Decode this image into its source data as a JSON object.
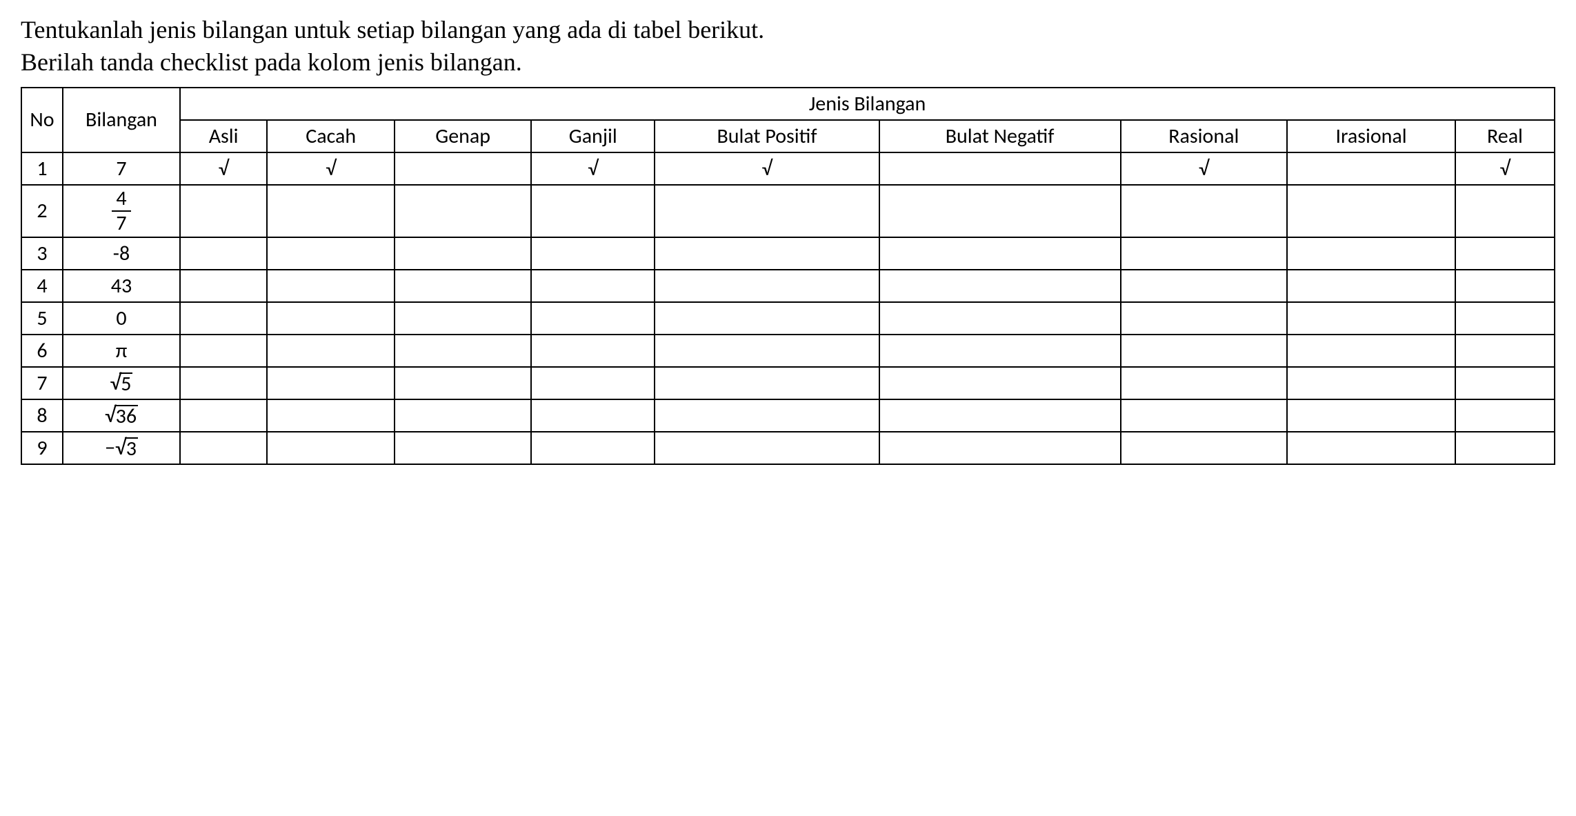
{
  "instruction": {
    "line1": "Tentukanlah jenis bilangan untuk setiap bilangan yang ada di tabel berikut.",
    "line2": "Berilah tanda checklist pada kolom jenis bilangan."
  },
  "headers": {
    "no": "No",
    "bilangan": "Bilangan",
    "jenis": "Jenis Bilangan",
    "cols": {
      "asli": "Asli",
      "cacah": "Cacah",
      "genap": "Genap",
      "ganjil": "Ganjil",
      "bulat_positif": "Bulat Positif",
      "bulat_negatif": "Bulat Negatif",
      "rasional": "Rasional",
      "irasional": "Irasional",
      "real": "Real"
    }
  },
  "check_symbol": "√",
  "rows": [
    {
      "no": "1",
      "bilangan": {
        "type": "text",
        "value": "7"
      },
      "check": {
        "asli": true,
        "cacah": true,
        "genap": false,
        "ganjil": true,
        "bulat_positif": true,
        "bulat_negatif": false,
        "rasional": true,
        "irasional": false,
        "real": true
      }
    },
    {
      "no": "2",
      "bilangan": {
        "type": "frac",
        "num": "4",
        "den": "7"
      },
      "check": {
        "asli": false,
        "cacah": false,
        "genap": false,
        "ganjil": false,
        "bulat_positif": false,
        "bulat_negatif": false,
        "rasional": false,
        "irasional": false,
        "real": false
      }
    },
    {
      "no": "3",
      "bilangan": {
        "type": "text",
        "value": "-8"
      },
      "check": {
        "asli": false,
        "cacah": false,
        "genap": false,
        "ganjil": false,
        "bulat_positif": false,
        "bulat_negatif": false,
        "rasional": false,
        "irasional": false,
        "real": false
      }
    },
    {
      "no": "4",
      "bilangan": {
        "type": "text",
        "value": "43"
      },
      "check": {
        "asli": false,
        "cacah": false,
        "genap": false,
        "ganjil": false,
        "bulat_positif": false,
        "bulat_negatif": false,
        "rasional": false,
        "irasional": false,
        "real": false
      }
    },
    {
      "no": "5",
      "bilangan": {
        "type": "text",
        "value": "0"
      },
      "check": {
        "asli": false,
        "cacah": false,
        "genap": false,
        "ganjil": false,
        "bulat_positif": false,
        "bulat_negatif": false,
        "rasional": false,
        "irasional": false,
        "real": false
      }
    },
    {
      "no": "6",
      "bilangan": {
        "type": "text",
        "value": "π"
      },
      "check": {
        "asli": false,
        "cacah": false,
        "genap": false,
        "ganjil": false,
        "bulat_positif": false,
        "bulat_negatif": false,
        "rasional": false,
        "irasional": false,
        "real": false
      }
    },
    {
      "no": "7",
      "bilangan": {
        "type": "sqrt",
        "prefix": "",
        "radicand": "5"
      },
      "check": {
        "asli": false,
        "cacah": false,
        "genap": false,
        "ganjil": false,
        "bulat_positif": false,
        "bulat_negatif": false,
        "rasional": false,
        "irasional": false,
        "real": false
      }
    },
    {
      "no": "8",
      "bilangan": {
        "type": "sqrt",
        "prefix": "",
        "radicand": "36"
      },
      "check": {
        "asli": false,
        "cacah": false,
        "genap": false,
        "ganjil": false,
        "bulat_positif": false,
        "bulat_negatif": false,
        "rasional": false,
        "irasional": false,
        "real": false
      }
    },
    {
      "no": "9",
      "bilangan": {
        "type": "sqrt",
        "prefix": "−",
        "radicand": "3"
      },
      "check": {
        "asli": false,
        "cacah": false,
        "genap": false,
        "ganjil": false,
        "bulat_positif": false,
        "bulat_negatif": false,
        "rasional": false,
        "irasional": false,
        "real": false
      }
    }
  ]
}
